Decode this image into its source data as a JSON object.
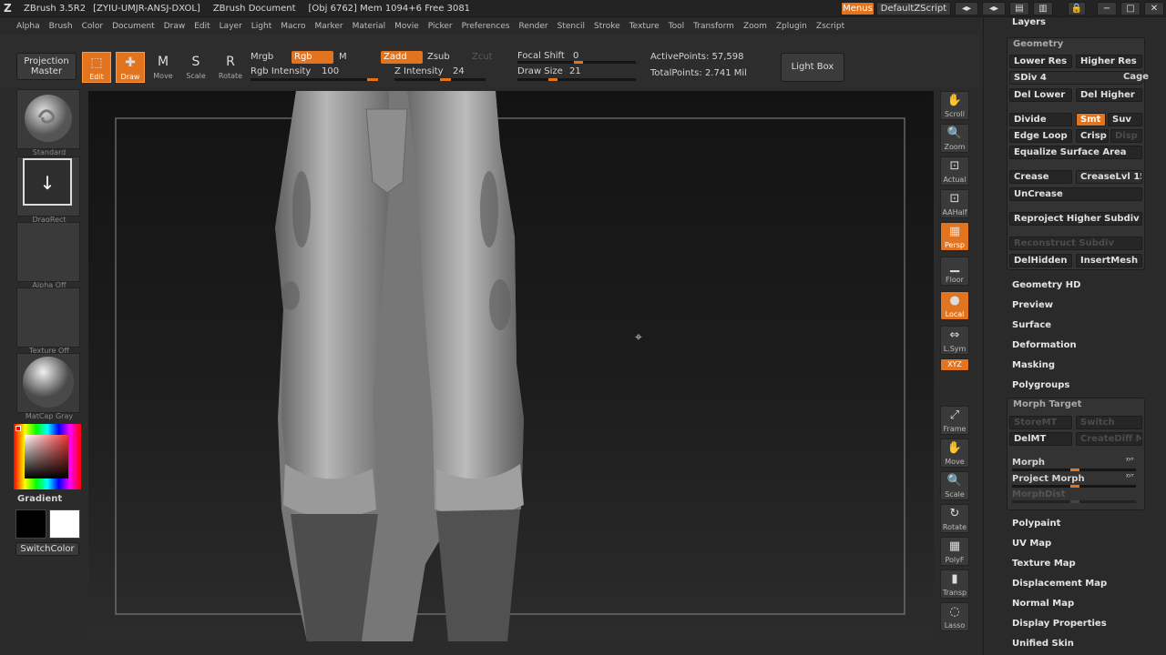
{
  "title_bar": {
    "app": "ZBrush 3.5R2",
    "session_code": "[ZYIU-UMJR-ANSJ-DXOL]",
    "document": "ZBrush Document",
    "stats": "[Obj 6762] Mem 1094+6  Free 3081",
    "menus_button": "Menus",
    "script_button": "DefaultZScript"
  },
  "menu_bar": [
    "Alpha",
    "Brush",
    "Color",
    "Document",
    "Draw",
    "Edit",
    "Layer",
    "Light",
    "Macro",
    "Marker",
    "Material",
    "Movie",
    "Picker",
    "Preferences",
    "Render",
    "Stencil",
    "Stroke",
    "Texture",
    "Tool",
    "Transform",
    "Zoom",
    "Zplugin",
    "Zscript"
  ],
  "toolbar": {
    "projection_master": "Projection Master",
    "tools": [
      {
        "label": "Edit",
        "icon": "edit-icon",
        "active": true
      },
      {
        "label": "Draw",
        "icon": "draw-icon",
        "active": true
      },
      {
        "label": "Move",
        "icon": "move-icon",
        "active": false
      },
      {
        "label": "Scale",
        "icon": "scale-icon",
        "active": false
      },
      {
        "label": "Rotate",
        "icon": "rotate-icon",
        "active": false
      }
    ],
    "mrgb": "Mrgb",
    "rgb": "Rgb",
    "m": "M",
    "zadd": "Zadd",
    "zsub": "Zsub",
    "zcut": "Zcut",
    "rgb_intensity_label": "Rgb Intensity",
    "rgb_intensity": "100",
    "z_intensity_label": "Z Intensity",
    "z_intensity": "24",
    "focal_shift_label": "Focal Shift",
    "focal_shift": "0",
    "draw_size_label": "Draw Size",
    "draw_size": "21",
    "active_points": "ActivePoints: 57,598",
    "total_points": "TotalPoints: 2.741  Mil",
    "light_box": "Light Box"
  },
  "left_shelf": {
    "brush": "Standard",
    "stroke": "DragRect",
    "alpha": "Alpha  Off",
    "texture": "Texture  Off",
    "material": "MatCap Gray",
    "gradient": "Gradient",
    "switch_color": "SwitchColor"
  },
  "right_shelf": [
    "Scroll",
    "Zoom",
    "Actual",
    "AAHalf",
    "Persp",
    "Floor",
    "Local",
    "L.Sym",
    "XYZ",
    "Frame",
    "Move",
    "Scale",
    "Rotate",
    "PolyF",
    "Transp",
    "Lasso"
  ],
  "tray": {
    "layers": "Layers",
    "geometry": {
      "title": "Geometry",
      "lower_res": "Lower Res",
      "higher_res": "Higher Res",
      "sdiv": "SDiv 4",
      "cage": "Cage",
      "del_lower": "Del Lower",
      "del_higher": "Del Higher",
      "divide": "Divide",
      "smt": "Smt",
      "suv": "Suv",
      "edge_loop": "Edge Loop",
      "crisp": "Crisp",
      "disp": "Disp",
      "equalize": "Equalize Surface Area",
      "crease": "Crease",
      "crease_lvl": "CreaseLvl",
      "crease_lvl_value": "15",
      "uncrease": "UnCrease",
      "reproject": "Reproject Higher Subdiv",
      "reconstruct": "Reconstruct Subdiv",
      "del_hidden": "DelHidden",
      "insert_mesh": "InsertMesh"
    },
    "sections_a": [
      "Geometry HD",
      "Preview",
      "Surface",
      "Deformation",
      "Masking",
      "Polygroups"
    ],
    "morph_target": {
      "title": "Morph Target",
      "store_mt": "StoreMT",
      "switch": "Switch",
      "del_mt": "DelMT",
      "create_diff": "CreateDiff M",
      "morph": "Morph",
      "project_morph": "Project Morph",
      "morph_dist": "MorphDist"
    },
    "sections_b": [
      "Polypaint",
      "UV Map",
      "Texture Map",
      "Displacement Map",
      "Normal Map",
      "Display Properties",
      "Unified Skin"
    ]
  }
}
